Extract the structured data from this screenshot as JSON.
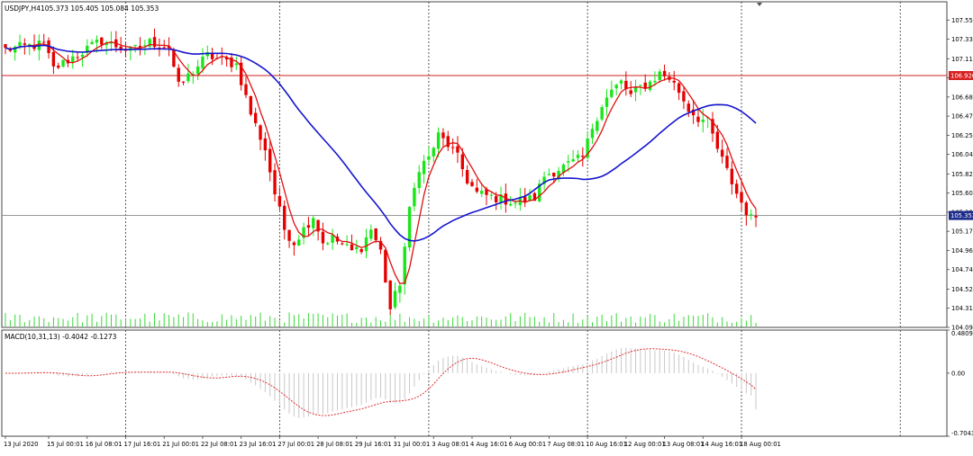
{
  "window": {
    "symbol_label": "USDJPY,H4",
    "ohlc_text": "105.373 105.405 105.084 105.353"
  },
  "colors": {
    "bull": "#19e619",
    "bear": "#e60000",
    "ma_fast": "#e01010",
    "ma_slow": "#1515d0",
    "volume": "#3ad83a",
    "hline_red": "#cc2222",
    "hline_gray": "#888888",
    "price_tag_red": "#d62020",
    "price_tag_blue": "#1c2a8a",
    "macd_hist": "#c8c8c8",
    "macd_signal": "#e03030",
    "grid": "#333333"
  },
  "chart_data": [
    {
      "type": "candlestick",
      "title": "",
      "price_axis": {
        "range": [
          104.095,
          107.755
        ],
        "ticks": [
          "107.550",
          "107.335",
          "107.115",
          "106.900",
          "106.685",
          "106.470",
          "106.255",
          "106.040",
          "105.820",
          "105.605",
          "105.390",
          "105.175",
          "104.960",
          "104.745",
          "104.525",
          "104.310",
          "104.095"
        ]
      },
      "horizontal_lines": [
        {
          "price": 106.926,
          "label": "106.926",
          "color": "red"
        },
        {
          "price": 105.353,
          "label": "105.353",
          "color": "gray"
        }
      ],
      "time_axis_labels": [
        {
          "label": "13 Jul 2020",
          "bar": 0
        },
        {
          "label": "15 Jul 00:01",
          "bar": 9
        },
        {
          "label": "16 Jul 08:01",
          "bar": 17
        },
        {
          "label": "17 Jul 16:01",
          "bar": 25
        },
        {
          "label": "21 Jul 00:01",
          "bar": 33
        },
        {
          "label": "22 Jul 08:01",
          "bar": 41
        },
        {
          "label": "23 Jul 16:01",
          "bar": 49
        },
        {
          "label": "27 Jul 00:01",
          "bar": 57
        },
        {
          "label": "28 Jul 08:01",
          "bar": 65
        },
        {
          "label": "29 Jul 16:01",
          "bar": 73
        },
        {
          "label": "31 Jul 00:01",
          "bar": 81
        },
        {
          "label": "3 Aug 08:01",
          "bar": 89
        },
        {
          "label": "4 Aug 16:01",
          "bar": 97
        },
        {
          "label": "6 Aug 00:01",
          "bar": 105
        },
        {
          "label": "7 Aug 08:01",
          "bar": 113
        },
        {
          "label": "10 Aug 16:01",
          "bar": 121
        },
        {
          "label": "12 Aug 00:01",
          "bar": 129
        },
        {
          "label": "13 Aug 08:01",
          "bar": 137
        },
        {
          "label": "14 Aug 16:01",
          "bar": 145
        },
        {
          "label": "18 Aug 00:01",
          "bar": 153
        }
      ],
      "vertical_grid_bars": [
        25,
        57,
        88,
        121,
        153,
        186
      ],
      "bar_count": 188,
      "close_path": [
        [
          0,
          107.22
        ],
        [
          8,
          107.28
        ],
        [
          10,
          107.0
        ],
        [
          13,
          107.1
        ],
        [
          20,
          107.32
        ],
        [
          26,
          107.2
        ],
        [
          30,
          107.3
        ],
        [
          34,
          107.25
        ],
        [
          36,
          106.8
        ],
        [
          38,
          106.92
        ],
        [
          42,
          107.15
        ],
        [
          48,
          107.05
        ],
        [
          51,
          106.5
        ],
        [
          54,
          106.1
        ],
        [
          56,
          105.6
        ],
        [
          58,
          105.2
        ],
        [
          60,
          105.05
        ],
        [
          62,
          105.2
        ],
        [
          64,
          105.35
        ],
        [
          66,
          105.05
        ],
        [
          68,
          105.1
        ],
        [
          72,
          104.95
        ],
        [
          74,
          105.0
        ],
        [
          76,
          105.2
        ],
        [
          78,
          104.95
        ],
        [
          80,
          104.3
        ],
        [
          82,
          104.6
        ],
        [
          84,
          105.4
        ],
        [
          86,
          105.9
        ],
        [
          88,
          106.0
        ],
        [
          90,
          106.25
        ],
        [
          92,
          106.15
        ],
        [
          94,
          106.0
        ],
        [
          96,
          105.75
        ],
        [
          98,
          105.6
        ],
        [
          102,
          105.55
        ],
        [
          106,
          105.5
        ],
        [
          110,
          105.55
        ],
        [
          112,
          105.8
        ],
        [
          116,
          105.9
        ],
        [
          120,
          106.0
        ],
        [
          122,
          106.35
        ],
        [
          124,
          106.6
        ],
        [
          126,
          106.75
        ],
        [
          128,
          106.85
        ],
        [
          130,
          106.7
        ],
        [
          132,
          106.8
        ],
        [
          134,
          106.85
        ],
        [
          136,
          106.95
        ],
        [
          138,
          106.9
        ],
        [
          140,
          106.75
        ],
        [
          142,
          106.55
        ],
        [
          144,
          106.45
        ],
        [
          146,
          106.4
        ],
        [
          148,
          106.1
        ],
        [
          150,
          105.85
        ],
        [
          152,
          105.6
        ],
        [
          154,
          105.4
        ],
        [
          155,
          105.32
        ],
        [
          156,
          105.35
        ]
      ],
      "moving_averages": [
        {
          "period": 5,
          "role": "fast"
        },
        {
          "period": 30,
          "role": "slow"
        }
      ]
    },
    {
      "type": "macd",
      "label": "MACD(10,31,13) -0.4042 -0.1273",
      "params": [
        10,
        31,
        13
      ],
      "main_value": -0.4042,
      "signal_value": -0.1273,
      "axis": {
        "range": [
          -0.7043,
          0.4809
        ],
        "ticks": [
          "0.4809",
          "0.00",
          "-0.7043"
        ]
      }
    }
  ]
}
